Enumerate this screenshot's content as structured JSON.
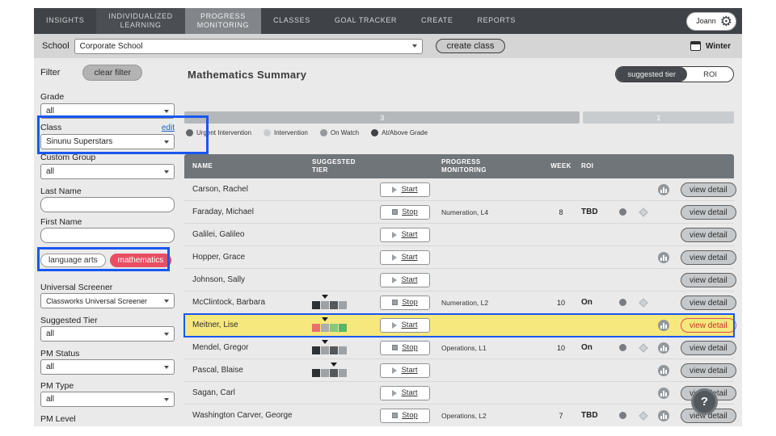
{
  "nav": {
    "items": [
      {
        "label": "INSIGHTS",
        "shade": false,
        "active": false
      },
      {
        "label": "INDIVIDUALIZED\nLEARNING",
        "shade": true,
        "active": false
      },
      {
        "label": "PROGRESS\nMONITORING",
        "shade": false,
        "active": true
      },
      {
        "label": "CLASSES",
        "shade": false,
        "active": false
      },
      {
        "label": "GOAL TRACKER",
        "shade": false,
        "active": false
      },
      {
        "label": "CREATE",
        "shade": false,
        "active": false
      },
      {
        "label": "REPORTS",
        "shade": false,
        "active": false
      }
    ],
    "user_name": "Joann"
  },
  "school_bar": {
    "label": "School",
    "school": "Corporate School",
    "create_class_label": "create class",
    "term": "Winter"
  },
  "sidebar": {
    "title": "Filter",
    "clear_filter_label": "clear filter",
    "grade": {
      "label": "Grade",
      "value": "all"
    },
    "class": {
      "label": "Class",
      "edit_label": "edit",
      "value": "Sinunu Superstars"
    },
    "custom_group": {
      "label": "Custom Group",
      "value": "all"
    },
    "last_name": {
      "label": "Last Name",
      "value": ""
    },
    "first_name": {
      "label": "First Name",
      "value": ""
    },
    "subjects": {
      "language_arts": "language arts",
      "mathematics": "mathematics"
    },
    "universal_screener": {
      "label": "Universal Screener",
      "value": "Classworks Universal Screener"
    },
    "suggested_tier": {
      "label": "Suggested Tier",
      "value": "all"
    },
    "pm_status": {
      "label": "PM Status",
      "value": "all"
    },
    "pm_type": {
      "label": "PM Type",
      "value": "all"
    },
    "pm_level": {
      "label": "PM Level"
    }
  },
  "main": {
    "title": "Mathematics Summary",
    "toggle": {
      "active_label": "suggested tier",
      "inactive_label": "ROI"
    },
    "tier_bar": {
      "segments": [
        {
          "count": "3",
          "width_pct": 72.4,
          "color": "#b5b8bb"
        },
        {
          "count": "1",
          "width_pct": 27.6,
          "color": "#c9cccf"
        }
      ]
    },
    "legend": [
      {
        "label": "Urgent Intervention",
        "color": "#63676b"
      },
      {
        "label": "Intervention",
        "color": "#c9cccf"
      },
      {
        "label": "On Watch",
        "color": "#95999d"
      },
      {
        "label": "At/Above Grade",
        "color": "#3e4246"
      }
    ],
    "table": {
      "headers": {
        "name": "NAME",
        "tier": "SUGGESTED\nTIER",
        "pm": "PROGRESS\nMONITORING",
        "week": "WEEK",
        "roi": "ROI"
      },
      "view_detail_label": "view detail",
      "rows": [
        {
          "name": "Carson, Rachel",
          "action": "Start",
          "pm": "",
          "week": "",
          "roi": "",
          "dot": false,
          "diamond": false,
          "chart": true,
          "highlight": false
        },
        {
          "name": "Faraday, Michael",
          "action": "Stop",
          "pm": "Numeration, L4",
          "week": "8",
          "roi": "TBD",
          "dot": true,
          "diamond": true,
          "chart": false,
          "highlight": false
        },
        {
          "name": "Galilei, Galileo",
          "action": "Start",
          "pm": "",
          "week": "",
          "roi": "",
          "dot": false,
          "diamond": false,
          "chart": false,
          "highlight": false
        },
        {
          "name": "Hopper, Grace",
          "action": "Start",
          "pm": "",
          "week": "",
          "roi": "",
          "dot": false,
          "diamond": false,
          "chart": true,
          "highlight": false
        },
        {
          "name": "Johnson, Sally",
          "action": "Start",
          "pm": "",
          "week": "",
          "roi": "",
          "dot": false,
          "diamond": false,
          "chart": false,
          "highlight": false
        },
        {
          "name": "McClintock, Barbara",
          "tier": {
            "colors": [
              "#2e3134",
              "#9ea2a5",
              "#54585b",
              "#9ea2a5"
            ],
            "marker": 1
          },
          "action": "Stop",
          "pm": "Numeration, L2",
          "week": "10",
          "roi": "On",
          "dot": true,
          "diamond": true,
          "chart": false,
          "highlight": false
        },
        {
          "name": "Meitner, Lise",
          "tier": {
            "colors": [
              "#e8706a",
              "#aaaeb1",
              "#86c77e",
              "#5cb464"
            ],
            "marker": 1
          },
          "action": "Start",
          "pm": "",
          "week": "",
          "roi": "",
          "dot": false,
          "diamond": false,
          "chart": true,
          "highlight": true
        },
        {
          "name": "Mendel, Gregor",
          "tier": {
            "colors": [
              "#2e3134",
              "#9ea2a5",
              "#54585b",
              "#9ea2a5"
            ],
            "marker": 1
          },
          "action": "Stop",
          "pm": "Operations, L1",
          "week": "10",
          "roi": "On",
          "dot": true,
          "diamond": true,
          "chart": true,
          "highlight": false
        },
        {
          "name": "Pascal, Blaise",
          "tier": {
            "colors": [
              "#2e3134",
              "#9ea2a5",
              "#54585b",
              "#9ea2a5"
            ],
            "marker": 2
          },
          "action": "Start",
          "pm": "",
          "week": "",
          "roi": "",
          "dot": false,
          "diamond": false,
          "chart": true,
          "highlight": false
        },
        {
          "name": "Sagan, Carl",
          "action": "Start",
          "pm": "",
          "week": "",
          "roi": "",
          "dot": false,
          "diamond": false,
          "chart": true,
          "highlight": false
        },
        {
          "name": "Washington Carver, George",
          "action": "Stop",
          "pm": "Operations, L2",
          "week": "7",
          "roi": "TBD",
          "dot": true,
          "diamond": true,
          "chart": true,
          "highlight": false
        }
      ]
    }
  },
  "help": {
    "label": "?"
  }
}
